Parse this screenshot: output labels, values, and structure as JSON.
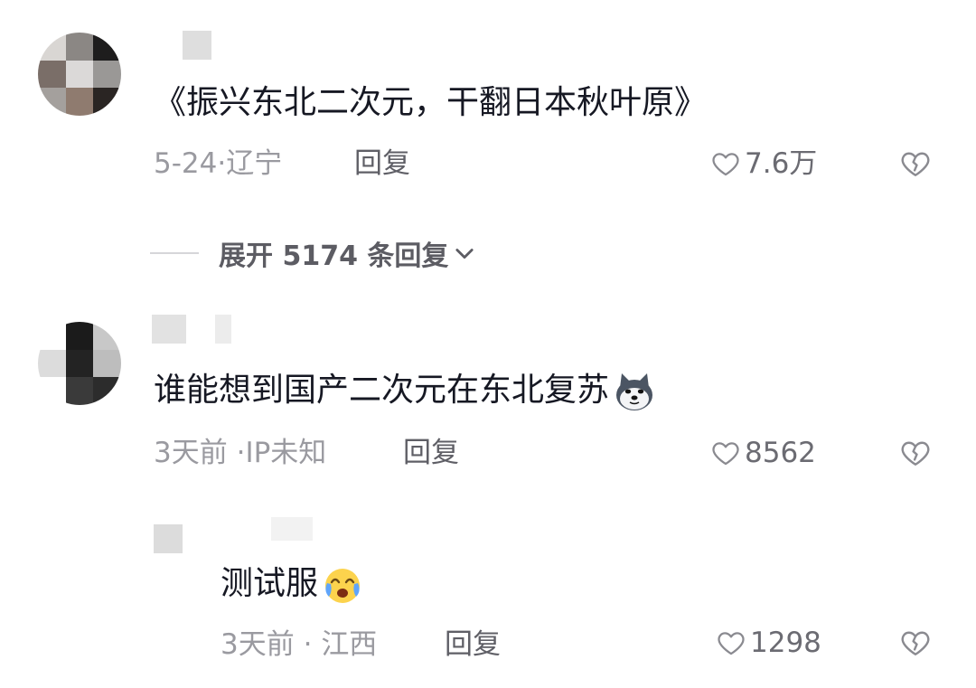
{
  "comments": [
    {
      "text": "《振兴东北二次元，干翻日本秋叶原》",
      "date": "5-24",
      "location_sep": "·",
      "location": "辽宁",
      "reply_label": "回复",
      "likes": "7.6万",
      "expand_label": "展开 5174 条回复"
    },
    {
      "text": "谁能想到国产二次元在东北复苏",
      "emoji": "husky-dog-emoji",
      "date": "3天前",
      "location_sep": "·",
      "location": "IP未知",
      "reply_label": "回复",
      "likes": "8562"
    }
  ],
  "reply": {
    "text": "测试服",
    "emoji": "tearful-laugh-emoji",
    "date": "3天前",
    "location_sep": "·",
    "location": "江西",
    "reply_label": "回复",
    "likes": "1298"
  },
  "colors": {
    "text_primary": "#161823",
    "text_meta": "#9a9aa0",
    "divider": "#d6d6d9"
  },
  "icons": [
    "heart-outline-icon",
    "broken-heart-icon",
    "chevron-down-icon"
  ]
}
